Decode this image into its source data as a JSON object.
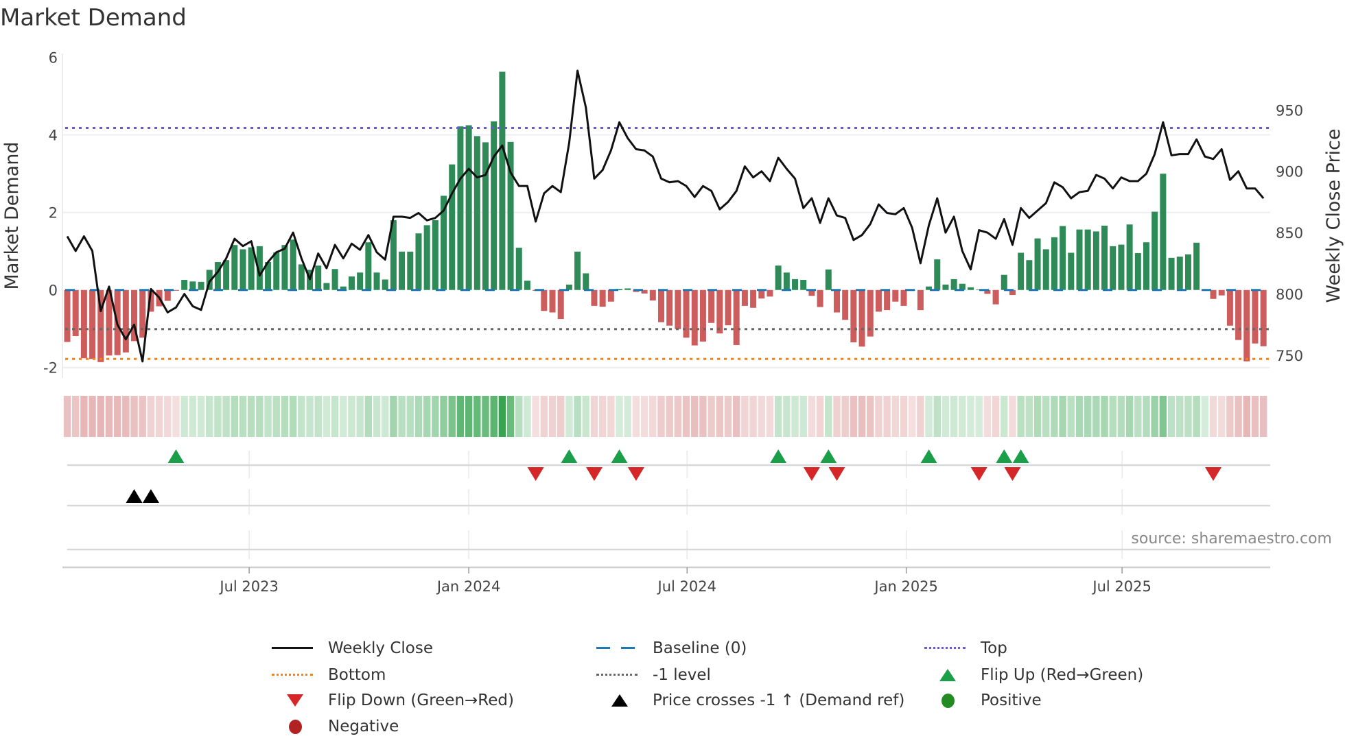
{
  "chart_data": {
    "type": "bar",
    "title": "Market Demand",
    "ylabel": "Market Demand",
    "y2label": "Weekly Close Price",
    "ylim": [
      -2.27,
      6.1
    ],
    "y2lim": [
      731.5,
      996
    ],
    "yticks": [
      -2,
      0,
      2,
      4,
      6
    ],
    "y2ticks": [
      750,
      800,
      850,
      900,
      950
    ],
    "x_start": "2023-01-30",
    "x_step_days": 7,
    "xticks": [
      {
        "label": "Jul 2023",
        "index": 21.75
      },
      {
        "label": "Jan 2024",
        "index": 48
      },
      {
        "label": "Jul 2024",
        "index": 74.1
      },
      {
        "label": "Jan 2025",
        "index": 100.3
      },
      {
        "label": "Jul 2025",
        "index": 126.1
      }
    ],
    "series": [
      {
        "name": "Market Demand",
        "type": "bar",
        "values": [
          -1.34,
          -1.19,
          -1.76,
          -1.78,
          -1.86,
          -1.69,
          -1.68,
          -1.61,
          -1.32,
          -1.23,
          -0.56,
          -0.42,
          -0.28,
          -0.02,
          0.26,
          0.22,
          0.21,
          0.52,
          0.72,
          0.77,
          1.16,
          1.05,
          1.1,
          1.13,
          0.72,
          0.97,
          1.16,
          1.3,
          0.66,
          0.52,
          0.63,
          0.18,
          0.54,
          0.09,
          0.35,
          0.45,
          1.23,
          0.45,
          0.27,
          1.8,
          0.99,
          0.99,
          1.46,
          1.67,
          1.8,
          2.43,
          3.24,
          4.22,
          4.25,
          3.97,
          3.81,
          4.35,
          5.63,
          3.82,
          1.09,
          0.24,
          -0.02,
          -0.54,
          -0.58,
          -0.75,
          0.14,
          0.99,
          0.43,
          -0.41,
          -0.43,
          -0.3,
          0.03,
          0.04,
          -0.05,
          -0.09,
          -0.27,
          -0.83,
          -0.92,
          -1.01,
          -1.23,
          -1.43,
          -1.33,
          -0.85,
          -1.12,
          -0.91,
          -1.42,
          -0.41,
          -0.46,
          -0.22,
          -0.17,
          0.63,
          0.45,
          0.28,
          0.26,
          -0.15,
          -0.44,
          0.53,
          -0.58,
          -0.77,
          -1.35,
          -1.46,
          -1.2,
          -0.56,
          -0.52,
          -0.3,
          -0.41,
          -0.02,
          -0.52,
          0.09,
          0.79,
          0.14,
          0.28,
          0.16,
          0.07,
          0.01,
          -0.1,
          -0.37,
          0.39,
          -0.13,
          0.96,
          0.77,
          1.33,
          1.05,
          1.36,
          1.65,
          0.96,
          1.56,
          1.56,
          1.51,
          1.66,
          1.13,
          1.17,
          1.69,
          0.95,
          1.23,
          2.02,
          3.0,
          0.83,
          0.86,
          0.92,
          1.22,
          0.02,
          -0.23,
          -0.14,
          -0.92,
          -1.29,
          -1.84,
          -1.38,
          -1.45
        ]
      },
      {
        "name": "Weekly Close",
        "type": "line",
        "axis": "y2",
        "values": [
          847,
          835,
          847,
          835,
          786,
          806,
          775,
          763,
          775,
          745,
          804,
          797,
          785,
          789,
          800,
          790,
          787,
          810,
          818,
          829,
          845,
          839,
          843,
          815,
          826,
          834,
          837,
          850,
          829,
          812,
          833,
          821,
          840,
          829,
          841,
          836,
          848,
          834,
          828,
          863,
          863,
          862,
          866,
          860,
          862,
          868,
          882,
          894,
          902,
          895,
          897,
          912,
          921,
          899,
          888,
          888,
          859,
          882,
          888,
          883,
          923,
          982,
          952,
          894,
          901,
          917,
          940,
          927,
          918,
          917,
          912,
          894,
          891,
          892,
          888,
          879,
          888,
          884,
          869,
          875,
          884,
          904,
          895,
          900,
          892,
          911,
          902,
          894,
          870,
          878,
          858,
          878,
          864,
          862,
          844,
          848,
          857,
          873,
          866,
          865,
          870,
          854,
          825,
          856,
          878,
          850,
          863,
          835,
          820,
          852,
          850,
          845,
          861,
          840,
          870,
          862,
          868,
          874,
          891,
          887,
          878,
          883,
          884,
          897,
          894,
          886,
          895,
          892,
          892,
          898,
          914,
          940,
          913,
          914,
          914,
          926,
          912,
          910,
          918,
          893,
          900,
          886,
          886,
          878
        ]
      }
    ],
    "reference_lines": [
      {
        "name": "Baseline (0)",
        "value": 0,
        "color": "#1f77b4",
        "style": "dash"
      },
      {
        "name": "Top",
        "value": 4.18,
        "color": "#6a5acd",
        "style": "dot"
      },
      {
        "name": "-1 level",
        "value": -1.01,
        "color": "#666666",
        "style": "dot"
      },
      {
        "name": "Bottom",
        "value": -1.78,
        "color": "#ff7f0e",
        "style": "dot"
      }
    ],
    "flip_up_indices": [
      13,
      60,
      66,
      85,
      91,
      103,
      112,
      114
    ],
    "flip_down_indices": [
      56,
      63,
      68,
      89,
      92,
      109,
      113,
      137
    ],
    "price_cross_indices": [
      8,
      10
    ],
    "colors": {
      "positive": "#2e8b57",
      "negative": "#cd5c5c",
      "line": "#111111",
      "flip_up": "#1a9e4a",
      "flip_down": "#d62728",
      "cross": "#000000",
      "positive_dot": "#228b22",
      "negative_dot": "#b22222"
    },
    "legend": [
      {
        "label": "Weekly Close",
        "symbol": "line"
      },
      {
        "label": "Baseline (0)",
        "symbol": "dash"
      },
      {
        "label": "Top",
        "symbol": "dot-top"
      },
      {
        "label": "Bottom",
        "symbol": "dot-bottom"
      },
      {
        "label": "-1 level",
        "symbol": "dot-minus1"
      },
      {
        "label": "Flip Up (Red→Green)",
        "symbol": "tri-up-green"
      },
      {
        "label": "Flip Down (Green→Red)",
        "symbol": "tri-down-red"
      },
      {
        "label": "Price crosses -1 ↑ (Demand ref)",
        "symbol": "tri-up-black"
      },
      {
        "label": "Positive",
        "symbol": "dot-green"
      },
      {
        "label": "Negative",
        "symbol": "dot-red"
      }
    ],
    "legend_placement": "bottom",
    "source": "source: sharemaestro.com"
  }
}
